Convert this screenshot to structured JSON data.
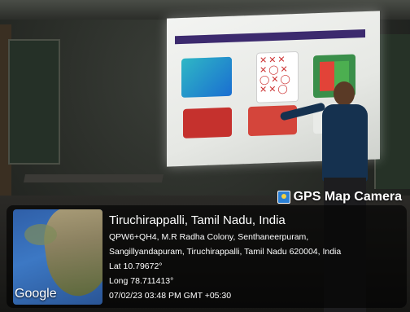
{
  "watermark": {
    "brand": "GPS Map Camera",
    "brand_icon": "gps-map-camera-icon"
  },
  "geotag": {
    "place": "Tiruchirappalli, Tamil Nadu, India",
    "address_line1": "QPW6+QH4, M.R Radha Colony, Senthaneerpuram,",
    "address_line2": "Sangillyandapuram, Tiruchirappalli, Tamil Nadu 620004, India",
    "lat": "Lat 10.79672°",
    "long": "Long 78.711413°",
    "datetime": "07/02/23 03:48 PM GMT +05:30"
  },
  "map": {
    "attribution": "Google"
  }
}
